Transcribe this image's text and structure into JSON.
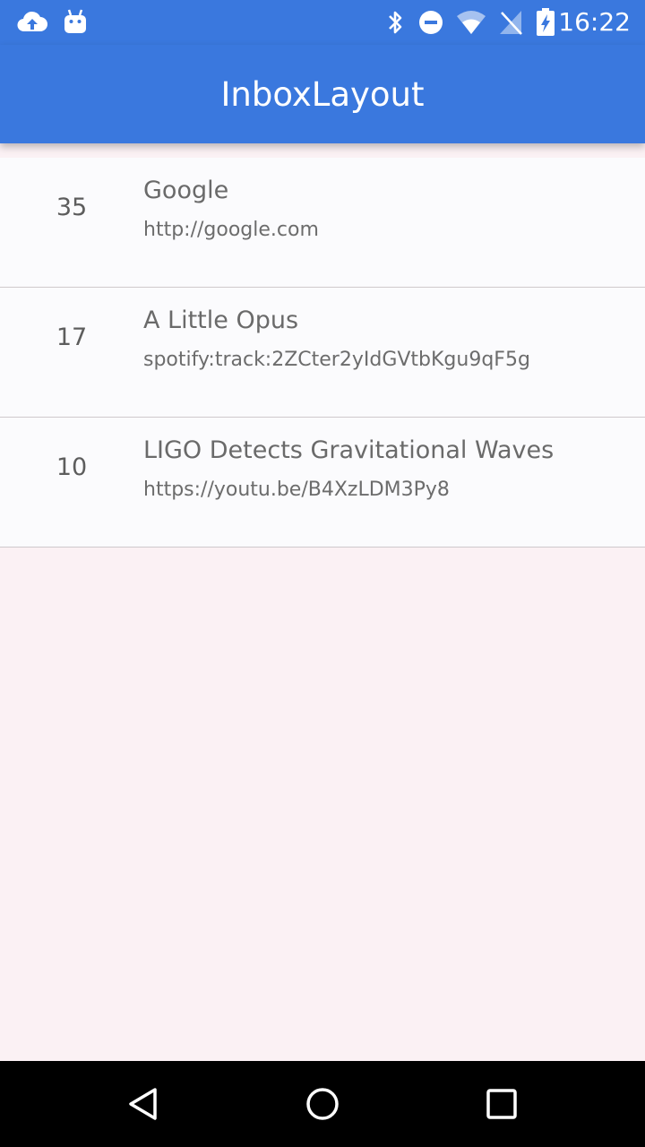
{
  "status_bar": {
    "time": "16:22",
    "icons": [
      "cloud-upload-icon",
      "android-icon",
      "bluetooth-icon",
      "do-not-disturb-icon",
      "wifi-icon",
      "no-signal-icon",
      "battery-charging-icon"
    ]
  },
  "app_bar": {
    "title": "InboxLayout"
  },
  "inbox": {
    "items": [
      {
        "count": "35",
        "title": "Google",
        "url": "http://google.com"
      },
      {
        "count": "17",
        "title": "A Little Opus",
        "url": "spotify:track:2ZCter2yIdGVtbKgu9qF5g"
      },
      {
        "count": "10",
        "title": "LIGO Detects Gravitational Waves",
        "url": "https://youtu.be/B4XzLDM3Py8"
      }
    ]
  },
  "nav_bar": {
    "buttons": [
      "back-icon",
      "home-icon",
      "recents-icon"
    ]
  },
  "colors": {
    "primary": "#3a78de",
    "background": "#fbf1f4",
    "row": "#fbfbfd"
  }
}
